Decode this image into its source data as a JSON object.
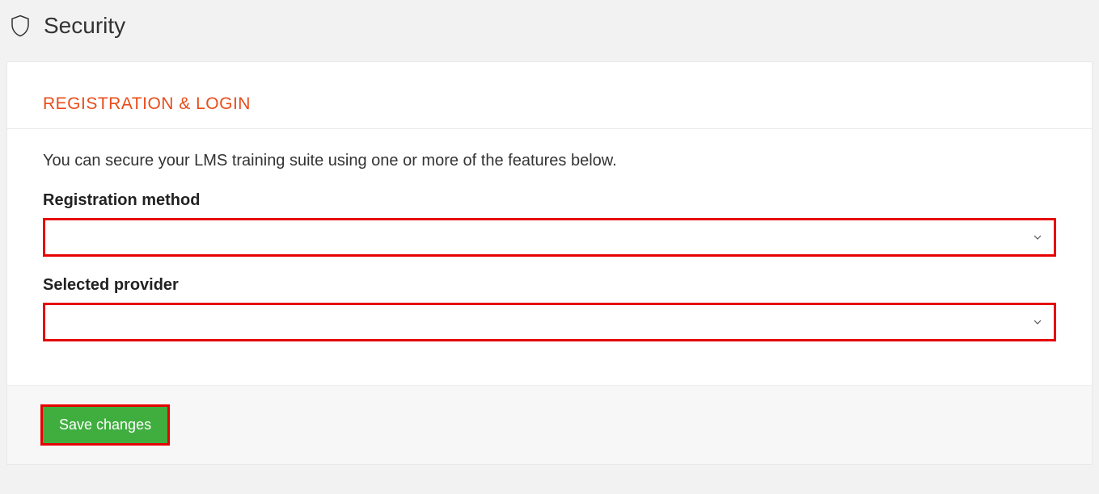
{
  "header": {
    "title": "Security"
  },
  "section": {
    "heading": "REGISTRATION & LOGIN",
    "intro": "You can secure your LMS training suite using one or more of the features below."
  },
  "fields": {
    "registration_method": {
      "label": "Registration method",
      "value": ""
    },
    "selected_provider": {
      "label": "Selected provider",
      "value": ""
    }
  },
  "actions": {
    "save_label": "Save changes"
  }
}
